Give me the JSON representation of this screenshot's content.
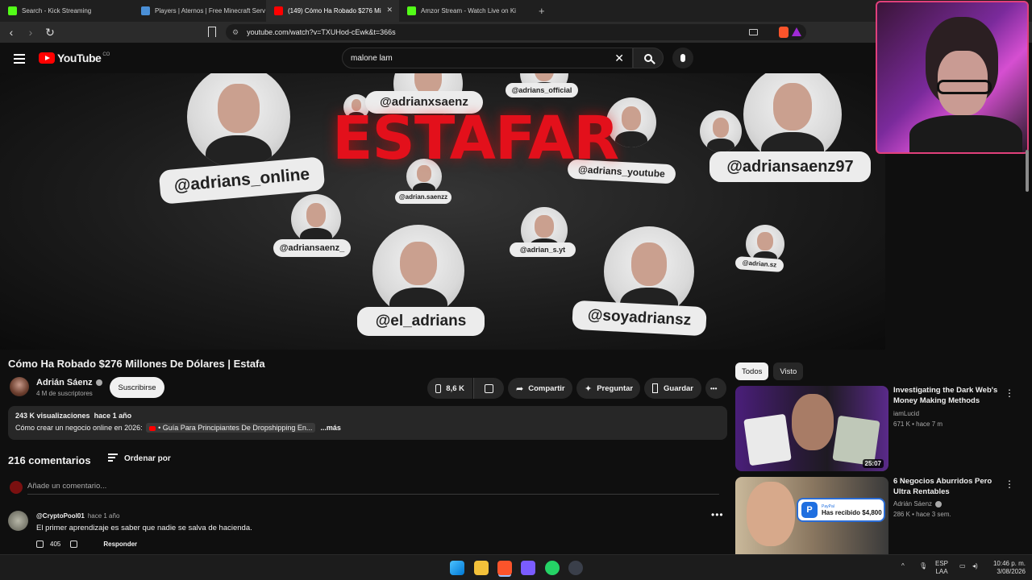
{
  "browser": {
    "tabs": [
      {
        "title": "Search - Kick Streaming",
        "color": "#53fc18",
        "active": false
      },
      {
        "title": "Players | Aternos | Free Minecraft Serv",
        "color": "#4a8fd6",
        "active": false
      },
      {
        "title": "(149) Cómo Ha Robado $276 Mi",
        "color": "#ff0000",
        "active": true
      },
      {
        "title": "Amzor Stream - Watch Live on Ki",
        "color": "#53fc18",
        "active": false
      }
    ],
    "new_tab": "+",
    "url": "youtube.com/watch?v=TXUHod-cEwk&t=366s"
  },
  "youtube": {
    "logo_text": "YouTube",
    "country": "CO",
    "search_value": "malone lam"
  },
  "player": {
    "headline": "ESTAFAR",
    "handles": [
      "@adrianxsaenz",
      "@adrians_official",
      "@adrians_online",
      "@adriansaenz97",
      "@adrians_youtube",
      "@adrian.saenzz",
      "@adriansaenz_",
      "@adrian_s.yt",
      "@adrian.sz",
      "@el_adrians",
      "@soyadriansz"
    ]
  },
  "video": {
    "title": "Cómo Ha Robado $276 Millones De Dólares | Estafa",
    "channel": "Adrián Sáenz",
    "subscribers": "4 M de suscriptores",
    "subscribe_label": "Suscribirse",
    "likes": "8,6 K",
    "share_label": "Compartir",
    "ask_label": "Preguntar",
    "save_label": "Guardar",
    "more_label": "•••",
    "description": {
      "views": "243 K visualizaciones",
      "age": "hace 1 año",
      "text": "Cómo crear un negocio online en 2026:",
      "link": "• Guía Para Principiantes De Dropshipping En...",
      "more": "...más"
    }
  },
  "comments": {
    "count": "216 comentarios",
    "sort_label": "Ordenar por",
    "add_placeholder": "Añade un comentario...",
    "items": [
      {
        "author": "@CryptoPool01",
        "age": "hace 1 año",
        "text": "El primer aprendizaje es saber que nadie se salva de hacienda.",
        "likes": "405",
        "reply": "Responder"
      }
    ]
  },
  "sidebar": {
    "chips": [
      "Todos",
      "Visto"
    ],
    "videos": [
      {
        "title": "Investigating the Dark Web's Money Making Methods",
        "channel": "iamLucid",
        "views": "671 K",
        "age": "hace 7 m",
        "duration": "25:07"
      },
      {
        "title": "6 Negocios Aburridos Pero Ultra Rentables",
        "channel": "Adrián Sáenz",
        "views": "286 K",
        "age": "hace 3 sem.",
        "paypal_brand": "PayPal",
        "paypal_text": "Has recibido $4,800"
      }
    ]
  },
  "taskbar": {
    "lang_top": "ESP",
    "lang_bottom": "LAA",
    "time": "10:46 p. m.",
    "date": "3/08/2026"
  }
}
